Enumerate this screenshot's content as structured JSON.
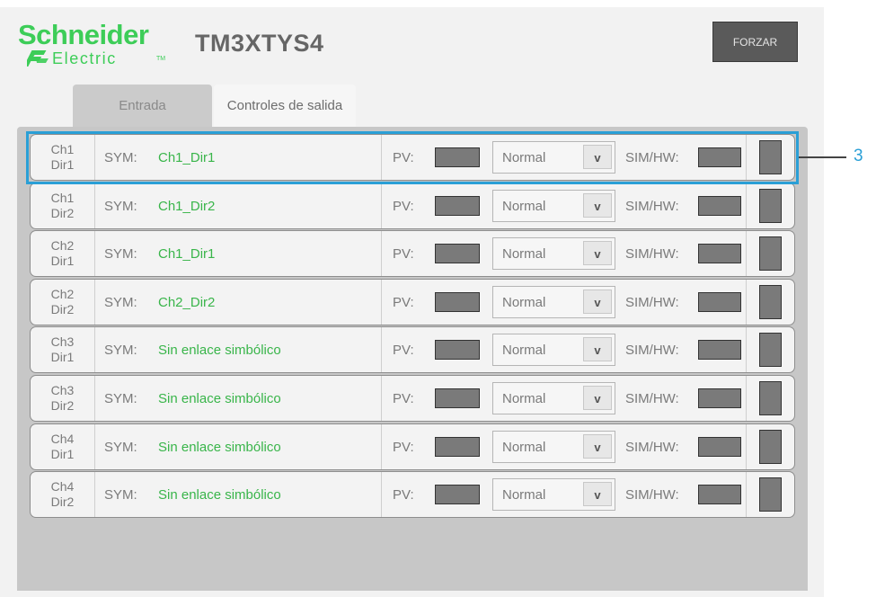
{
  "brand": {
    "name_top": "Schneider",
    "name_bottom": "Electric",
    "trademark": "TM",
    "color": "#3dcd58"
  },
  "device_title": "TM3XTYS4",
  "force_button_label": "FORZAR",
  "tabs": [
    {
      "label": "Entrada",
      "active": false
    },
    {
      "label": "Controles de salida",
      "active": true
    }
  ],
  "field_labels": {
    "sym": "SYM:",
    "pv": "PV:",
    "simhw": "SIM/HW:"
  },
  "select_arrow": "v",
  "rows": [
    {
      "channel": "Ch1\nDir1",
      "sym": "Ch1_Dir1",
      "mode": "Normal"
    },
    {
      "channel": "Ch1\nDir2",
      "sym": "Ch1_Dir2",
      "mode": "Normal"
    },
    {
      "channel": "Ch2\nDir1",
      "sym": "Ch1_Dir1",
      "mode": "Normal"
    },
    {
      "channel": "Ch2\nDir2",
      "sym": "Ch2_Dir2",
      "mode": "Normal"
    },
    {
      "channel": "Ch3\nDir1",
      "sym": "Sin enlace simbólico",
      "mode": "Normal"
    },
    {
      "channel": "Ch3\nDir2",
      "sym": "Sin enlace simbólico",
      "mode": "Normal"
    },
    {
      "channel": "Ch4\nDir1",
      "sym": "Sin enlace simbólico",
      "mode": "Normal"
    },
    {
      "channel": "Ch4\nDir2",
      "sym": "Sin enlace simbólico",
      "mode": "Normal"
    }
  ],
  "callout": {
    "number": "3",
    "color": "#2a9fd6"
  },
  "colors": {
    "symbol_text": "#39b54a",
    "indicator": "#7a7a7a",
    "force_button": "#5a5a5a"
  }
}
